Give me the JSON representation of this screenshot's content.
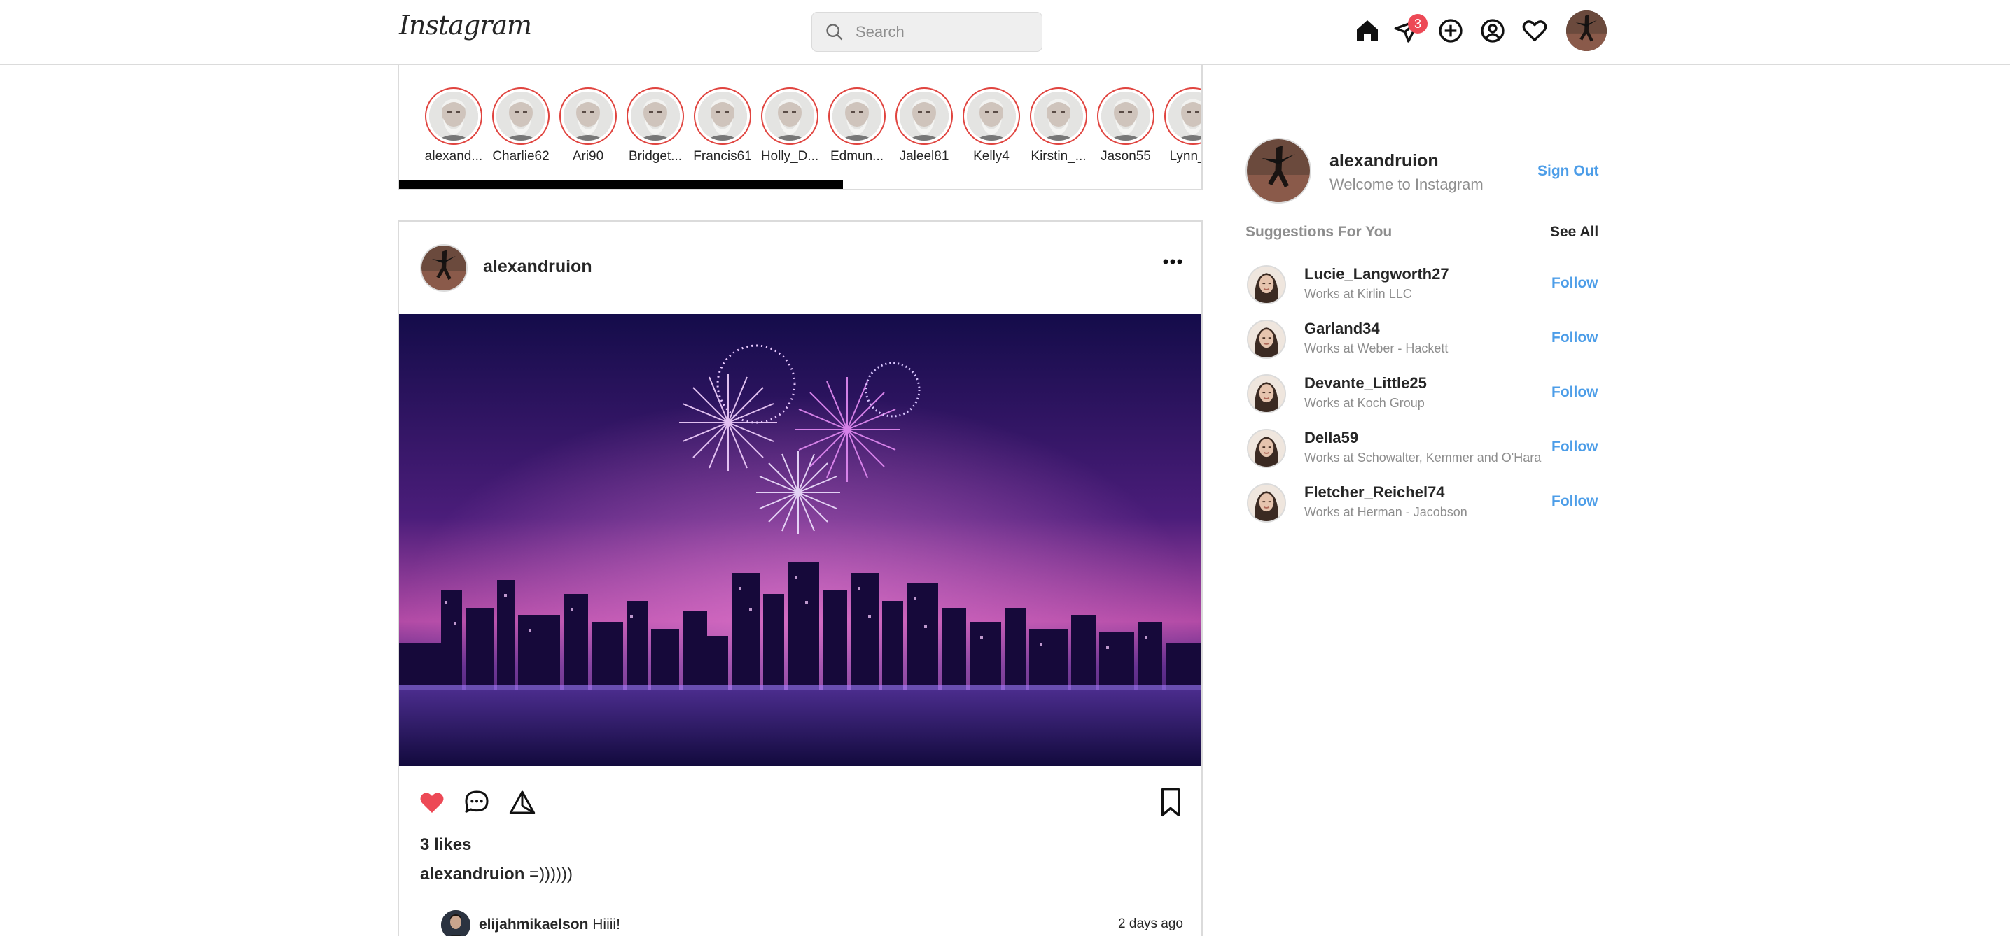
{
  "header": {
    "logo": "Instagram",
    "search_placeholder": "Search",
    "messages_badge": "3",
    "icons": [
      "home-icon",
      "messages-icon",
      "new-post-icon",
      "profile-icon",
      "activity-icon"
    ]
  },
  "stories": {
    "items": [
      {
        "name": "alexand..."
      },
      {
        "name": "Charlie62"
      },
      {
        "name": "Ari90"
      },
      {
        "name": "Bridget..."
      },
      {
        "name": "Francis61"
      },
      {
        "name": "Holly_D..."
      },
      {
        "name": "Edmun..."
      },
      {
        "name": "Jaleel81"
      },
      {
        "name": "Kelly4"
      },
      {
        "name": "Kirstin_..."
      },
      {
        "name": "Jason55"
      },
      {
        "name": "Lynn_..."
      }
    ]
  },
  "post": {
    "username": "alexandruion",
    "likes": "3 likes",
    "caption_user": "alexandruion",
    "caption_text": "=))))))",
    "liked": true,
    "comment": {
      "user": "elijahmikaelson",
      "text": "Hiiii!",
      "time": "2 days ago"
    }
  },
  "sidebar": {
    "username": "alexandruion",
    "subtitle": "Welcome to Instagram",
    "sign_out": "Sign Out",
    "suggestions_title": "Suggestions For You",
    "see_all": "See All",
    "follow_label": "Follow",
    "suggestions": [
      {
        "name": "Lucie_Langworth27",
        "sub": "Works at Kirlin LLC"
      },
      {
        "name": "Garland34",
        "sub": "Works at Weber - Hackett"
      },
      {
        "name": "Devante_Little25",
        "sub": "Works at Koch Group"
      },
      {
        "name": "Della59",
        "sub": "Works at Schowalter, Kemmer and O'Hara"
      },
      {
        "name": "Fletcher_Reichel74",
        "sub": "Works at Herman - Jacobson"
      }
    ]
  },
  "colors": {
    "accent": "#4c9de8",
    "like": "#ed4956",
    "story_ring": "#e0443f",
    "muted": "#8e8e8e",
    "border": "#dbdbdb"
  }
}
